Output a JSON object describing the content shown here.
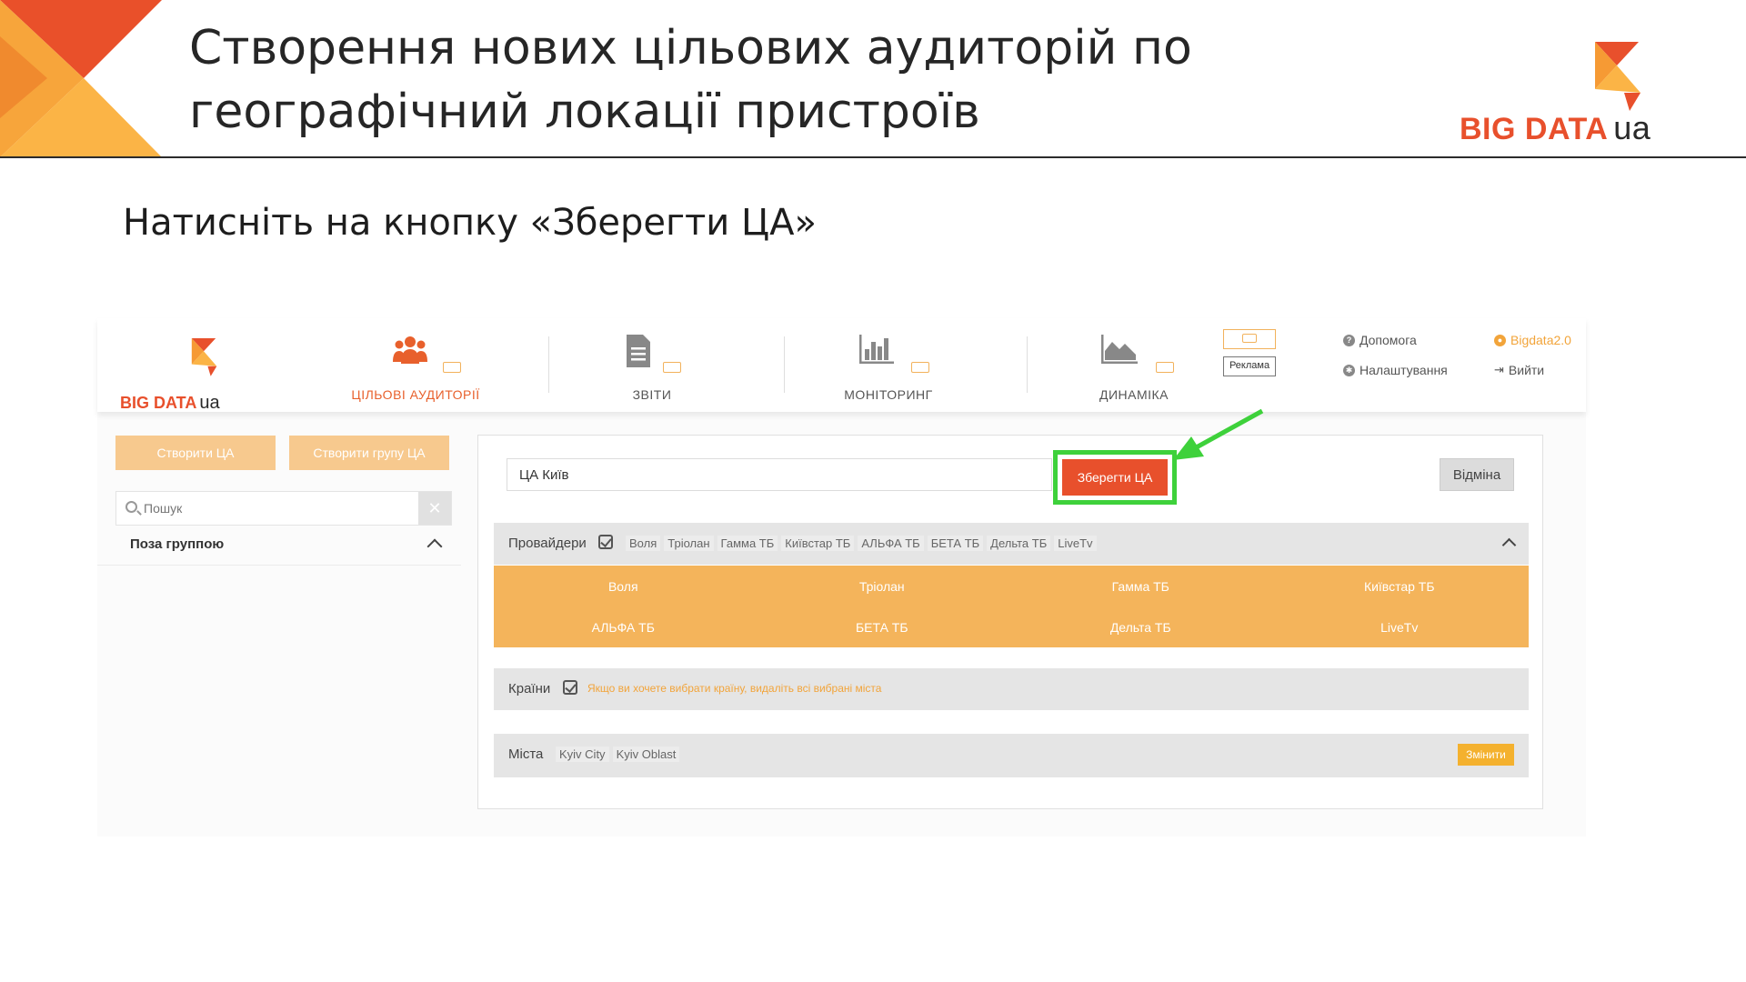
{
  "slide": {
    "title_line1": "Створення нових цільових аудиторій по",
    "title_line2": "географічний локації пристроїв",
    "logo_word": "BIG DATA",
    "logo_suffix": "ua",
    "instruction": "Натисніть на кнопку «Зберегти ЦА»"
  },
  "app": {
    "logo_word": "BIG DATA",
    "logo_suffix": "ua",
    "nav": [
      {
        "label": "ЦІЛЬОВІ АУДИТОРІЇ",
        "icon": "users-icon",
        "active": true
      },
      {
        "label": "ЗВІТИ",
        "icon": "document-icon"
      },
      {
        "label": "МОНІТОРИНГ",
        "icon": "bar-chart-icon"
      },
      {
        "label": "ДИНАМІКА",
        "icon": "area-chart-icon"
      }
    ],
    "ad_label": "Реклама",
    "help": "Допомога",
    "settings": "Налаштування",
    "user": "Bigdata2.0",
    "logout": "Вийти"
  },
  "sidebar": {
    "create_label": "Створити ЦА",
    "create_group_label": "Створити групу ЦА",
    "search_placeholder": "Пошук",
    "group_label": "Поза группою"
  },
  "editor": {
    "name_value": "ЦА Київ",
    "save_label": "Зберегти ЦА",
    "cancel_label": "Відміна",
    "providers": {
      "label": "Провайдери",
      "chips": [
        "Воля",
        "Тріолан",
        "Гамма ТБ",
        "Київстар ТБ",
        "АЛЬФА ТБ",
        "БЕТА ТБ",
        "Дельта ТБ",
        "LiveTv"
      ],
      "options": [
        "Воля",
        "Тріолан",
        "Гамма ТБ",
        "Київстар ТБ",
        "АЛЬФА ТБ",
        "БЕТА ТБ",
        "Дельта ТБ",
        "LiveTv"
      ]
    },
    "countries": {
      "label": "Країни",
      "hint": "Якщо ви хочете вибрати країну, видаліть всі вибрані міста"
    },
    "cities": {
      "label": "Міста",
      "chips": [
        "Kyiv City",
        "Kyiv Oblast"
      ],
      "change_label": "Змінити"
    }
  },
  "colors": {
    "brand_orange": "#e8502c",
    "light_orange": "#f4b45b",
    "highlight_green": "#3ed13b"
  }
}
